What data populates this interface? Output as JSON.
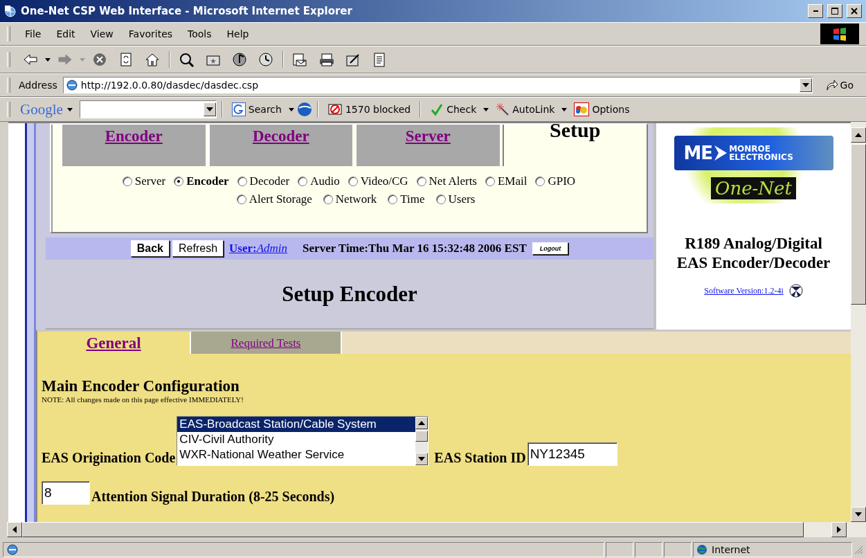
{
  "window": {
    "title": "One-Net CSP Web Interface - Microsoft Internet Explorer"
  },
  "menu": [
    "File",
    "Edit",
    "View",
    "Favorites",
    "Tools",
    "Help"
  ],
  "address": {
    "label": "Address",
    "value": "http://192.0.0.80/dasdec/dasdec.csp",
    "go": "Go"
  },
  "google_bar": {
    "brand": "Google",
    "search": "Search",
    "blocked": "1570 blocked",
    "check": "Check",
    "autolink": "AutoLink",
    "options": "Options"
  },
  "main_tabs": [
    {
      "label": "Encoder",
      "selected": false
    },
    {
      "label": "Decoder",
      "selected": false
    },
    {
      "label": "Server",
      "selected": false
    },
    {
      "label": "Setup",
      "selected": true
    }
  ],
  "setup_options": [
    [
      {
        "label": "Server",
        "selected": false
      },
      {
        "label": "Encoder",
        "selected": true
      },
      {
        "label": "Decoder",
        "selected": false
      },
      {
        "label": "Audio",
        "selected": false
      },
      {
        "label": "Video/CG",
        "selected": false
      },
      {
        "label": "Net Alerts",
        "selected": false
      },
      {
        "label": "EMail",
        "selected": false
      },
      {
        "label": "GPIO",
        "selected": false
      }
    ],
    [
      {
        "label": "Alert Storage",
        "selected": false
      },
      {
        "label": "Network",
        "selected": false
      },
      {
        "label": "Time",
        "selected": false
      },
      {
        "label": "Users",
        "selected": false
      }
    ]
  ],
  "nav": {
    "back": "Back",
    "refresh": "Refresh",
    "user_label": "User:",
    "user": "Admin",
    "server_time": "Server Time:Thu Mar 16 15:32:48 2006 EST",
    "logout": "Logout"
  },
  "page_title": "Setup Encoder",
  "product": {
    "logo_mark": "ME",
    "logo_line1": "MONROE",
    "logo_line2": "ELECTRONICS",
    "logo_brand": "One-Net",
    "title_lines": [
      "R189 Analog/Digital",
      "EAS Encoder/Decoder"
    ],
    "version": "Software Version:1.2-4i"
  },
  "sub_tabs": [
    {
      "label": "General",
      "selected": true
    },
    {
      "label": "Required Tests",
      "selected": false
    }
  ],
  "section": {
    "title": "Main Encoder Configuration",
    "note": "NOTE: All changes made on this page effective IMMEDIATELY!"
  },
  "origination": {
    "label": "EAS Origination Code",
    "options": [
      {
        "label": "EAS-Broadcast Station/Cable System",
        "selected": true
      },
      {
        "label": "CIV-Civil Authority",
        "selected": false
      },
      {
        "label": "WXR-National Weather Service",
        "selected": false
      }
    ]
  },
  "station_id": {
    "label": "EAS Station ID",
    "value": "NY12345"
  },
  "attention": {
    "value": "8",
    "label": "Attention Signal Duration (8-25 Seconds)"
  },
  "status_bar": {
    "zone": "Internet"
  }
}
